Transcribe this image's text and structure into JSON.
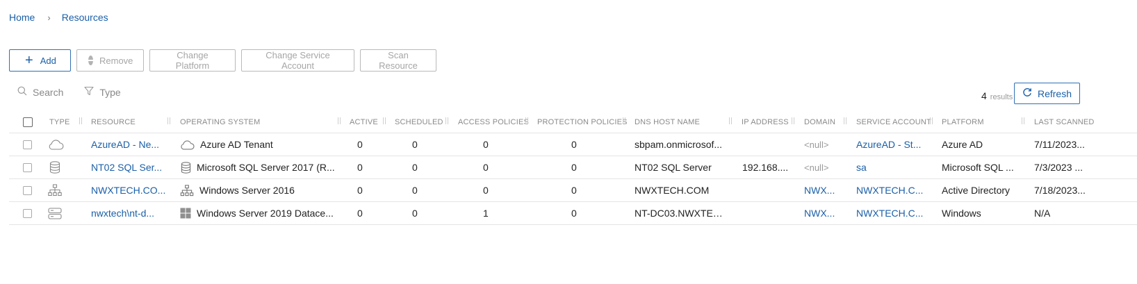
{
  "breadcrumb": {
    "home": "Home",
    "current": "Resources"
  },
  "toolbar": {
    "add": "Add",
    "remove": "Remove",
    "change_platform": "Change Platform",
    "change_service_account": "Change Service Account",
    "scan_resource": "Scan Resource"
  },
  "filters": {
    "search": "Search",
    "type": "Type"
  },
  "results": {
    "count": "4",
    "label": "results"
  },
  "refresh": "Refresh",
  "columns": {
    "type": "TYPE",
    "resource": "RESOURCE",
    "operating_system": "OPERATING SYSTEM",
    "active": "ACTIVE",
    "scheduled": "SCHEDULED",
    "access_policies": "ACCESS POLICIES",
    "protection_policies": "PROTECTION POLICIES",
    "dns_host_name": "DNS HOST NAME",
    "ip_address": "IP ADDRESS",
    "domain": "DOMAIN",
    "service_account": "SERVICE ACCOUNT",
    "platform": "PLATFORM",
    "last_scanned": "LAST SCANNED"
  },
  "rows": [
    {
      "type_icon": "cloud-icon",
      "resource": "AzureAD - Ne...",
      "os_icon": "cloud-icon",
      "os": "Azure AD Tenant",
      "active": "0",
      "scheduled": "0",
      "access_policies": "0",
      "protection_policies": "0",
      "dns_host_name": "sbpam.onmicrosof...",
      "ip_address": "",
      "domain": "<null>",
      "service_account": "AzureAD - St...",
      "platform": "Azure AD",
      "last_scanned": "7/11/2023..."
    },
    {
      "type_icon": "database-icon",
      "resource": "NT02 SQL Ser...",
      "os_icon": "database-icon",
      "os": "Microsoft SQL Server 2017 (R...",
      "active": "0",
      "scheduled": "0",
      "access_policies": "0",
      "protection_policies": "0",
      "dns_host_name": "NT02 SQL Server",
      "ip_address": "192.168....",
      "domain": "<null>",
      "service_account": "sa",
      "platform": "Microsoft SQL ...",
      "last_scanned": "7/3/2023 ..."
    },
    {
      "type_icon": "org-tree-icon",
      "resource": "NWXTECH.CO...",
      "os_icon": "org-tree-icon",
      "os": "Windows Server 2016",
      "active": "0",
      "scheduled": "0",
      "access_policies": "0",
      "protection_policies": "0",
      "dns_host_name": "NWXTECH.COM",
      "ip_address": "",
      "domain": "NWX...",
      "service_account": "NWXTECH.C...",
      "platform": "Active Directory",
      "last_scanned": "7/18/2023..."
    },
    {
      "type_icon": "server-icon",
      "resource": "nwxtech\\nt-d...",
      "os_icon": "windows-logo-icon",
      "os": "Windows Server 2019 Datace...",
      "active": "0",
      "scheduled": "0",
      "access_policies": "1",
      "protection_policies": "0",
      "dns_host_name": "NT-DC03.NWXTEC...",
      "ip_address": "",
      "domain": "NWX...",
      "service_account": "NWXTECH.C...",
      "platform": "Windows",
      "last_scanned": "N/A"
    }
  ],
  "colors": {
    "accent": "#1a5fa8",
    "border": "#b9b9b9",
    "muted": "#8a8a8a",
    "null_text": "#9a9a9a"
  }
}
